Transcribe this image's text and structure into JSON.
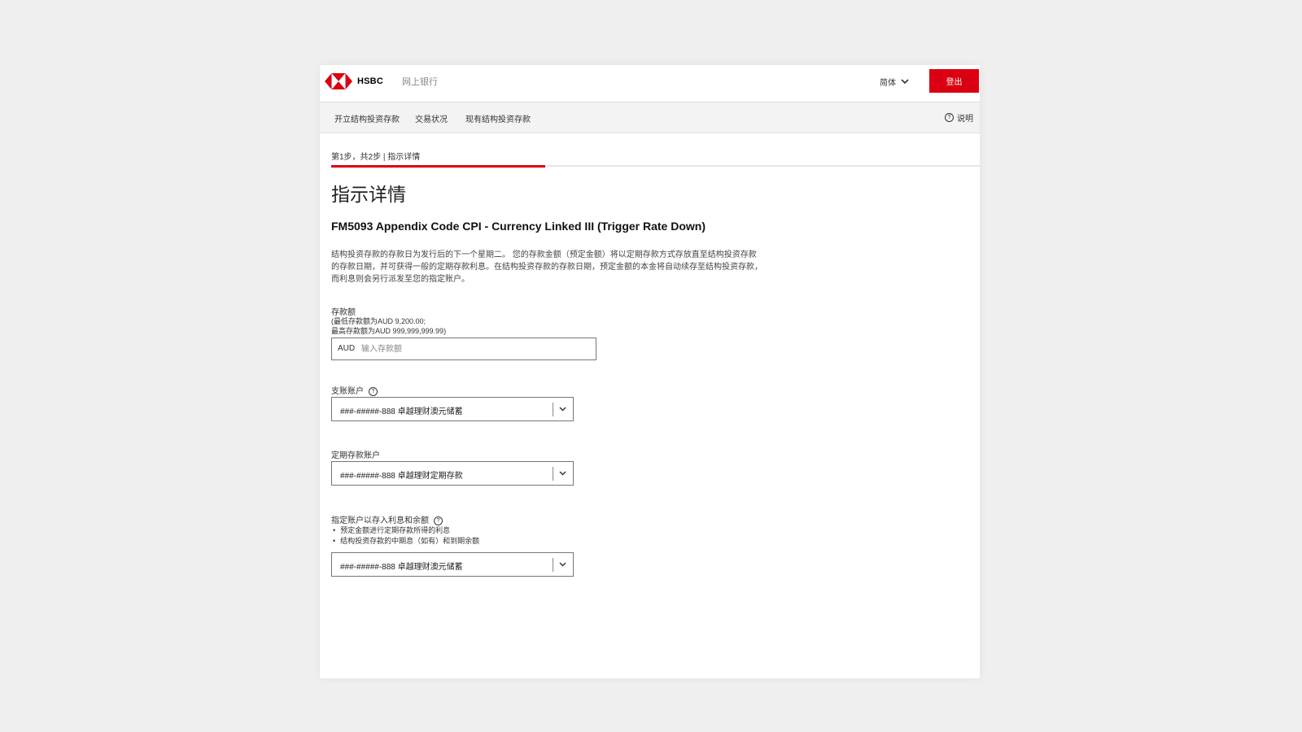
{
  "header": {
    "brand": "HSBC",
    "app_name": "网上银行",
    "language": "简体",
    "logout_label": "登出",
    "brand_color": "#db0011"
  },
  "subnav": {
    "tabs": [
      {
        "label": "开立结构投资存款"
      },
      {
        "label": "交易状况"
      },
      {
        "label": "现有结构投资存款"
      }
    ],
    "help_label": "说明"
  },
  "step": {
    "text": "第1步，共2步 | 指示详情",
    "progress": 0.33
  },
  "page_title": "指示详情",
  "product_title": "FM5093 Appendix Code CPI - Currency Linked III (Trigger Rate Down)",
  "description": "结构投资存款的存款日为发行后的下一个星期二。 您的存款金额（预定金额）将以定期存款方式存放直至结构投资存款的存款日期，并可获得一般的定期存款利息。在结构投资存款的存款日期，预定金额的本金将自动续存至结构投资存款，而利息则会另行派发至您的指定账户。",
  "deposit": {
    "label": "存款额",
    "min_hint": "(最低存款额为AUD 9,200.00;",
    "max_hint": "最高存款额为AUD 999,999,999.99)",
    "currency": "AUD",
    "placeholder": "输入存款额",
    "value": ""
  },
  "debit_account": {
    "label": "支账账户",
    "help_icon": "question-circle-icon",
    "value": "###-#####-888 卓越理财澳元储蓄"
  },
  "time_deposit_account": {
    "label": "定期存款账户",
    "value": "###-#####-888 卓越理财定期存款"
  },
  "designated_account": {
    "label": "指定账户以存入利息和余额",
    "help_icon": "question-circle-icon",
    "bullets": [
      "预定金额进行定期存款所得的利息",
      "结构投资存款的中期息（如有）和到期余额"
    ],
    "value": "###-#####-888 卓越理财澳元储蓄"
  }
}
